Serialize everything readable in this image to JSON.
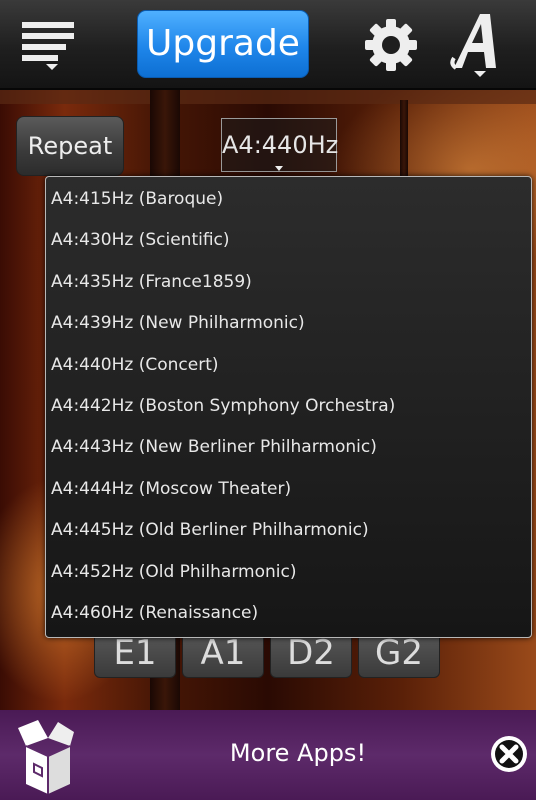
{
  "toolbar": {
    "menu_icon": "menu-lines-icon",
    "upgrade_label": "Upgrade",
    "settings_icon": "gear-icon",
    "font_icon": "font-a-icon",
    "accent_color": "#1f86ea"
  },
  "controls": {
    "repeat_label": "Repeat",
    "tuning_selected": "A4:440Hz"
  },
  "tuning_options": [
    "A4:415Hz (Baroque)",
    "A4:430Hz (Scientific)",
    "A4:435Hz (France1859)",
    "A4:439Hz (New Philharmonic)",
    "A4:440Hz (Concert)",
    "A4:442Hz (Boston Symphony Orchestra)",
    "A4:443Hz (New Berliner Philharmonic)",
    "A4:444Hz (Moscow Theater)",
    "A4:445Hz (Old Berliner Philharmonic)",
    "A4:452Hz (Old Philharmonic)",
    "A4:460Hz (Renaissance)"
  ],
  "string_keys": [
    "E1",
    "A1",
    "D2",
    "G2"
  ],
  "banner": {
    "more_apps_label": "More Apps!",
    "box_icon": "open-box-icon",
    "close_icon": "close-icon",
    "color": "#5d2a6a"
  }
}
